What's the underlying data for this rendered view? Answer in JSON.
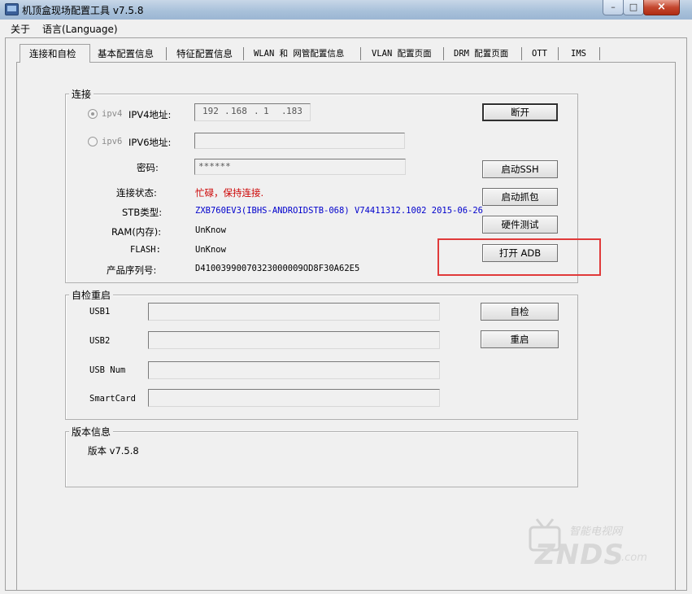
{
  "window": {
    "title": "机顶盒现场配置工具 v7.5.8",
    "controls": {
      "minimize": "–",
      "maximize": "□",
      "close": "×"
    }
  },
  "menu": {
    "items": [
      "关于",
      "语言(Language)"
    ]
  },
  "tabs": [
    "连接和自检",
    "基本配置信息",
    "特征配置信息",
    "WLAN 和 网管配置信息",
    "VLAN 配置页面",
    "DRM 配置页面",
    "OTT",
    "IMS"
  ],
  "connection": {
    "group_title": "连接",
    "ipv4_radio": "ipv4",
    "ipv4_label": "IPV4地址:",
    "ipv4_octets": [
      "192",
      "168",
      "1",
      "183"
    ],
    "ipv6_radio": "ipv6",
    "ipv6_label": "IPV6地址:",
    "ipv6_value": "",
    "password_label": "密码:",
    "password_value": "******",
    "status_label": "连接状态:",
    "status_value": "忙碌，保持连接.",
    "stb_type_label": "STB类型:",
    "stb_type_value": "ZXB760EV3(IBHS-ANDROIDSTB-068) V74411312.1002 2015-06-26",
    "ram_label": "RAM(内存):",
    "ram_value": "UnKnow",
    "flash_label": "FLASH:",
    "flash_value": "UnKnow",
    "serial_label": "产品序列号:",
    "serial_value": "D41003990070323000009OD8F30A62E5",
    "buttons": {
      "disconnect": "断开",
      "start_ssh": "启动SSH",
      "start_capture": "启动抓包",
      "hardware_test": "硬件测试",
      "open_adb": "打开 ADB"
    }
  },
  "self_check": {
    "group_title": "自检重启",
    "usb1_label": "USB1",
    "usb2_label": "USB2",
    "usb_num_label": "USB Num",
    "smartcard_label": "SmartCard",
    "usb1_value": "",
    "usb2_value": "",
    "usb_num_value": "",
    "smartcard_value": "",
    "buttons": {
      "self_check": "自检",
      "reboot": "重启"
    }
  },
  "version": {
    "group_title": "版本信息",
    "text": "版本 v7.5.8"
  },
  "watermark": {
    "text": "ZNDS",
    "suffix": ".com",
    "tagline": "智能电视网"
  },
  "colors": {
    "status": "#cc0000",
    "stb_type": "#0000cc",
    "highlight": "#e03a3a"
  }
}
